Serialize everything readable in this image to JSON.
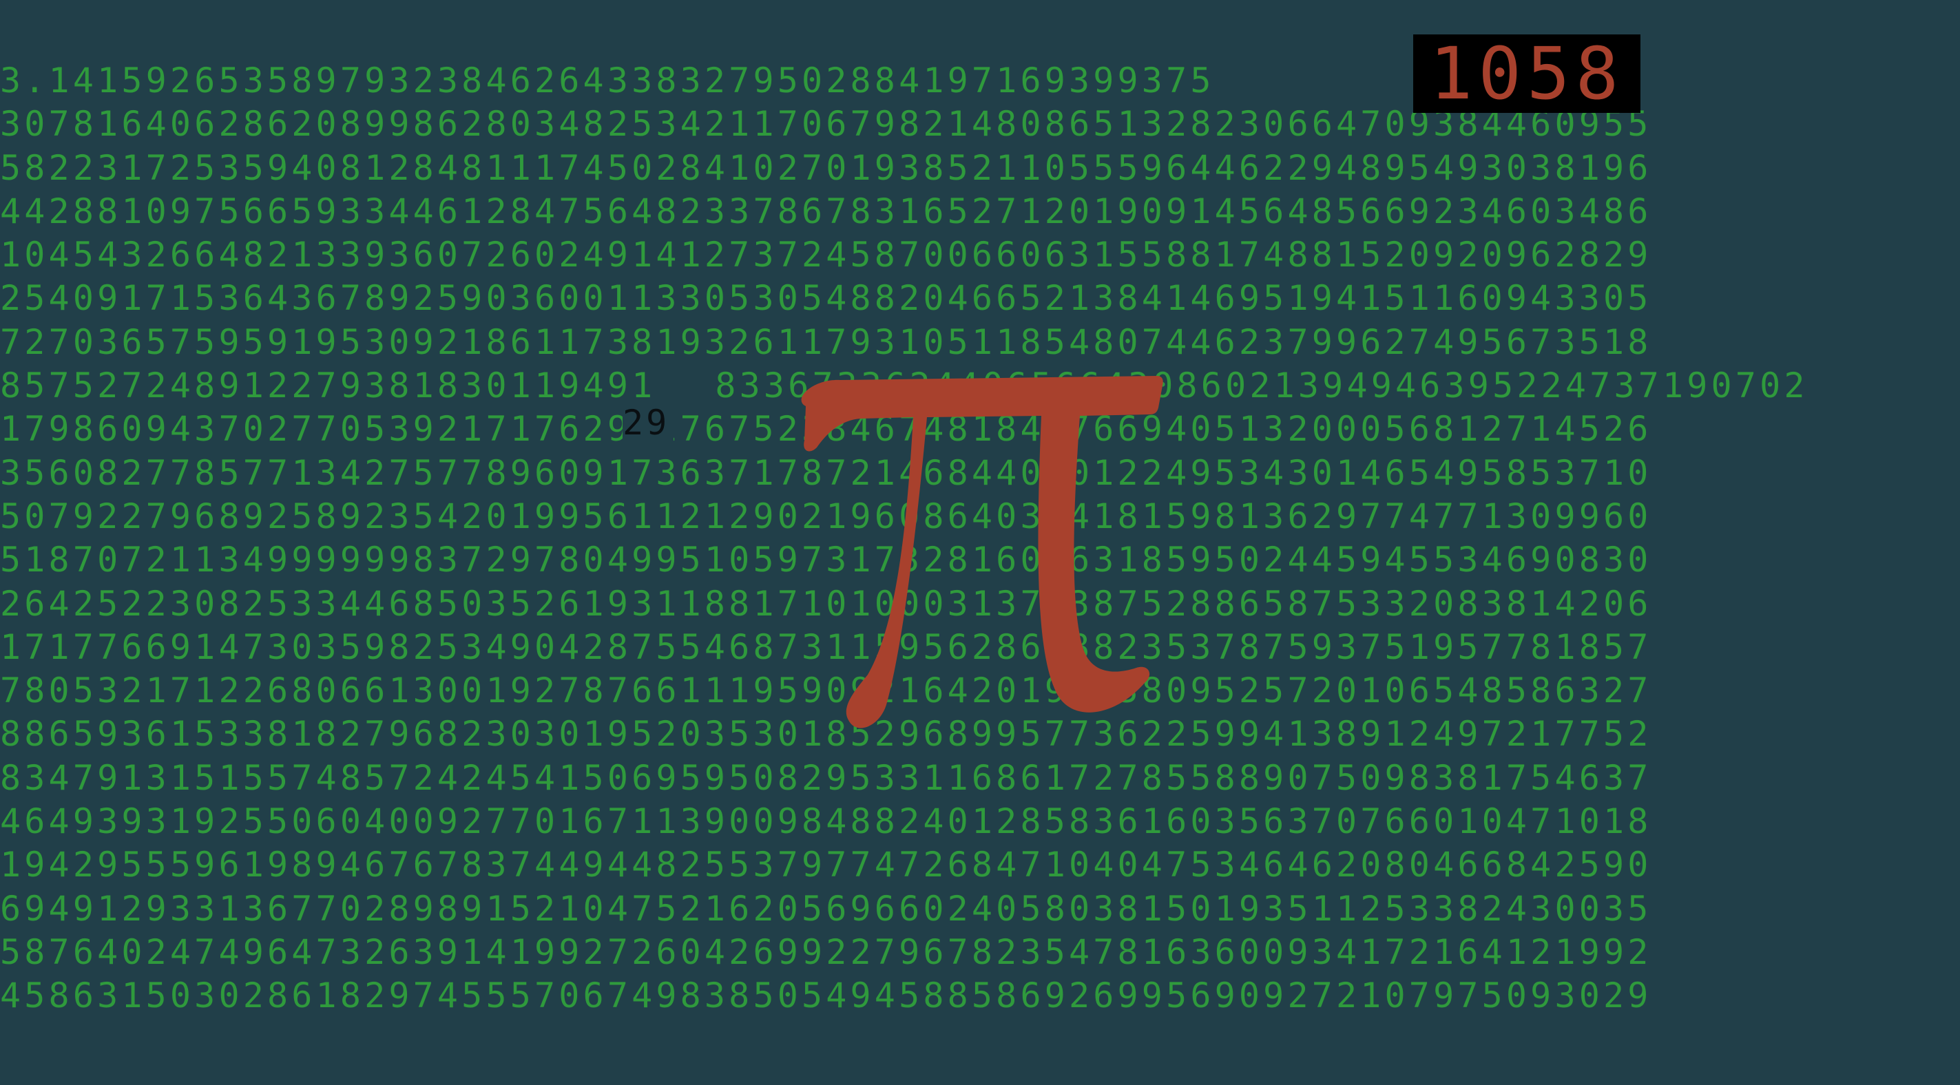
{
  "colors": {
    "background": "#213f49",
    "digits": "#2f9a3c",
    "pi_symbol": "#a8412d",
    "score_box": "#000000",
    "score_text": "#a8412d",
    "marker": "#0a0f12"
  },
  "score": {
    "value": "1058"
  },
  "marker": {
    "value": "29"
  },
  "pi_icon": "pi-symbol-icon",
  "digit_rows": [
    "3.141592653589793238462643383279502884197169399375",
    "30781640628620899862803482534211706798214808651328230664709384460955",
    "58223172535940812848111745028410270193852110555964462294895493038196",
    "44288109756659334461284756482337867831652712019091456485669234603486",
    "10454326648213393607260249141273724587006606315588174881520920962829",
    "25409171536436789259036001133053054882046652138414695194151160943305",
    "72703657595919530921861173819326117931051185480744623799627495673518",
    "857527248912279381830119491",
    "17986094370277053921717629317675238467481846766940513200056812714526",
    "35608277857713427577896091736371787214684409012249534301465495853710",
    "50792279689258923542019956112129021960864034418159813629774771309960",
    "51870721134999999837297804995105973173281609631859502445945534690830",
    "26425223082533446850352619311881710100031378387528865875332083814206",
    "17177669147303598253490428755468731159562863882353787593751957781857",
    "78053217122680661300192787661119590921642019893809525720106548586327",
    "88659361533818279682303019520353018529689957736225994138912497217752",
    "83479131515574857242454150695950829533116861727855889075098381754637",
    "46493931925506040092770167113900984882401285836160356370766010471018",
    "19429555961989467678374494482553797747268471040475346462080466842590",
    "69491293313677028989152104752162056966024058038150193511253382430035",
    "58764024749647326391419927260426992279678235478163600934172164121992",
    "45863150302861829745557067498385054945885869269956909272107975093029"
  ],
  "row_seven_tail": "833673362440656643086021394946395224737190702"
}
